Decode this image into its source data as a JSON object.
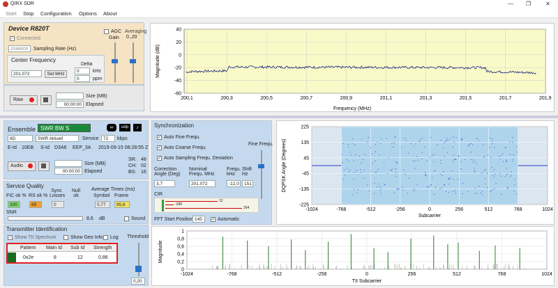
{
  "window": {
    "title": "QIRX SDR"
  },
  "menu": [
    "Start",
    "Stop",
    "Configuration",
    "Options",
    "About"
  ],
  "device": {
    "name": "Device R820T",
    "connected_label": "Connected",
    "sampling_rate_value": "2048000",
    "sampling_rate_label": "Sampling Rate (Hz)",
    "agc_label": "AGC",
    "gain_label": "Gain",
    "averaging_label": "Averaging",
    "averaging_value": "0.,20"
  },
  "center_freq": {
    "title": "Center Frequency",
    "value": "201,072",
    "set_mhz_label": "Set MHz",
    "delta_label": "Delta",
    "khz_value": "0",
    "khz_unit": "kHz",
    "ppm_value": "0",
    "ppm_unit": "ppm"
  },
  "recording": {
    "raw_label": "Raw",
    "size_label": "Size (MB)",
    "elapsed_value": "00:00:00",
    "elapsed_label": "Elapsed"
  },
  "ensemble": {
    "label": "Ensemble",
    "name": "SWR BW S",
    "block": "8D",
    "service_select": "SWR Aktuell",
    "service_label": "Service",
    "kbps_value": "72",
    "kbps_unit": "kbps",
    "eid_label": "E-Id",
    "eid_value": "10EB",
    "sid_label": "S-Id",
    "sid_value": "D3A6",
    "eep_value": "EEP_3A",
    "datetime": "2019-09-15  08:28:55 Z",
    "sr_label": "SR:",
    "sr_value": "48",
    "ch_label": "CH:",
    "ch_value": "02",
    "bs_label": "BS:",
    "bs_value": "16",
    "audio_label": "Audio",
    "size_label": "Size (MB)",
    "elapsed_value": "00:00:00",
    "elapsed_label": "Elapsed",
    "icon_udp": "udp"
  },
  "quality": {
    "title": "Service Quality",
    "fic_label": "FIC ok %",
    "rs_label": "RS ok %",
    "sync_label": "Sync Losses",
    "null_label": "Null ok",
    "avg_label": "Average Times (ms)",
    "symbol_label": "Symbol",
    "frame_label": "Frame",
    "fic_value": "100",
    "rs_value": "69",
    "sync_value": "0",
    "symbol_value": "0,77",
    "frame_value": "95,6",
    "snr_label": "SNR",
    "snr_value": "8,6",
    "snr_unit": "dB",
    "sound_label": "Sound"
  },
  "tii": {
    "title": "Transmitter Identification",
    "show_spectrum": "Show TII Spectrum",
    "show_geo": "Show Geo Info",
    "log_label": "Log",
    "threshold_label": "Threshold",
    "threshold_value": "0,20",
    "columns": [
      "Pattern",
      "Main Id",
      "Sub Id",
      "Strength"
    ],
    "row": [
      "0x2e",
      "8",
      "12",
      "0,86"
    ]
  },
  "sync": {
    "title": "Synchronization",
    "auto_fine": "Auto Fine Frequ.",
    "auto_coarse": "Auto Coarse Frequ.",
    "auto_sampling": "Auto Sampling Frequ. Deviation",
    "fine_freq_label": "Fine Frequ.",
    "corr_label": "Correction Angle (Deg)",
    "corr_value": "3,7",
    "nominal_label": "Nominal Frequ. MHz",
    "nominal_value": "201.072",
    "freq_label": "Frequ. kHz",
    "freq_value": "-12,0",
    "shift_label": "Shift Hz",
    "shift_value": "151",
    "cir_label": "CIR",
    "cir_mark1": "12",
    "cir_mark2": "-289",
    "cir_mark3": "264",
    "fft_label": "FFT Start Position",
    "fft_value": "145",
    "automatic_label": "Automatic"
  },
  "spectrum": {
    "ylabel": "Magnitude (dB)",
    "xlabel": "Frequency (MHz)",
    "yticks": [
      "40",
      "20",
      "0",
      "-20",
      "-40",
      "-60"
    ],
    "xticks": [
      "200,1",
      "200,3",
      "200,5",
      "200,7",
      "200,9",
      "201,1",
      "201,3",
      "201,5",
      "201,7",
      "201,9"
    ]
  },
  "constellation": {
    "ylabel": "DQPSK Angle (Degrees)",
    "xlabel": "Subcarrier",
    "yticks": [
      "225",
      "135",
      "45",
      "-45",
      "-135",
      "-225"
    ],
    "xticks": [
      "-1024",
      "-768",
      "-512",
      "-256",
      "0",
      "256",
      "512",
      "768",
      "1024"
    ]
  },
  "tii_chart": {
    "ylabel": "Magnitude",
    "xlabel": "TII Subcarrier",
    "yticks": [
      "1",
      "0,8",
      "0,6",
      "0,4",
      "0,2",
      "0"
    ],
    "xticks": [
      "-1024",
      "-768",
      "-512",
      "-256",
      "0",
      "256",
      "512",
      "768",
      "1024"
    ]
  },
  "colors": {
    "accent": "#2a72c8",
    "rec": "#e02020",
    "tan": "#f5e3c4",
    "panel_blue": "#c5d9ee",
    "plot_bg": "#fafac8",
    "ok_green": "#7ed36a",
    "warn_orange": "#f0a030"
  },
  "chart_data": [
    {
      "type": "line",
      "title": "",
      "xlabel": "Frequency (MHz)",
      "ylabel": "Magnitude (dB)",
      "xlim": [
        200.05,
        202.15
      ],
      "ylim": [
        -60,
        40
      ],
      "series": [
        {
          "values_x": [
            200.06,
            200.1,
            200.3,
            200.31,
            201.8,
            201.81,
            202.1
          ],
          "values_y": [
            -27,
            -26,
            -25,
            -19,
            -20,
            -26,
            -28
          ]
        }
      ]
    },
    {
      "type": "scatter",
      "title": "",
      "xlabel": "Subcarrier",
      "ylabel": "DQPSK Angle (Degrees)",
      "xlim": [
        -1024,
        1024
      ],
      "ylim": [
        -225,
        225
      ],
      "series": [
        {
          "name": "",
          "values": "points at 135, 45, -45, -135 for subcarriers -768..768"
        }
      ]
    },
    {
      "type": "bar",
      "title": "",
      "xlabel": "TII Subcarrier",
      "ylabel": "Magnitude",
      "xlim": [
        -1024,
        1024
      ],
      "ylim": [
        0,
        1
      ],
      "categories": [
        -820,
        -680,
        -560,
        -430,
        -350,
        -220,
        -90,
        40,
        120,
        250,
        380,
        460,
        520,
        640,
        730,
        870
      ],
      "values": [
        0.85,
        0.75,
        0.6,
        0.78,
        0.5,
        0.72,
        0.92,
        0.55,
        0.45,
        0.8,
        0.88,
        0.65,
        0.7,
        0.48,
        0.62,
        0.55
      ]
    }
  ]
}
